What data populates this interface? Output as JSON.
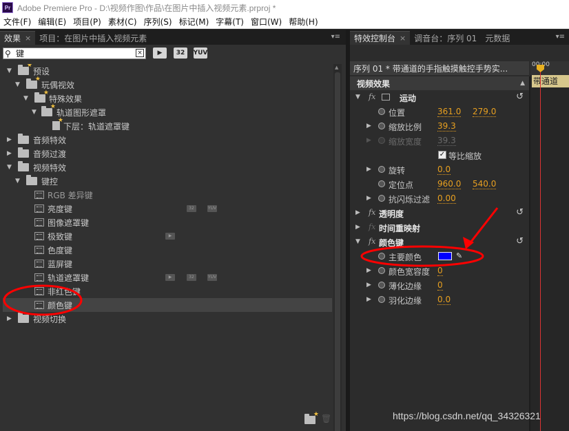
{
  "app": {
    "title": "Adobe Premiere Pro - D:\\视频作图\\作品\\在图片中插入视频元素.prproj *",
    "logo": "Pr"
  },
  "menu": [
    "文件(F)",
    "编辑(E)",
    "项目(P)",
    "素材(C)",
    "序列(S)",
    "标记(M)",
    "字幕(T)",
    "窗口(W)",
    "帮助(H)"
  ],
  "left_panel": {
    "tabs": [
      {
        "label": "效果",
        "close": "×",
        "active": true
      },
      {
        "label": "项目：在图片中插入视频元素",
        "active": false
      }
    ],
    "menu_icon": "▾≡",
    "search": {
      "value": "键",
      "clear": "×"
    },
    "filter_buttons": [
      "▶",
      "32",
      "YUV"
    ],
    "tree": [
      {
        "label": "预设",
        "level": 0,
        "kind": "folder-star",
        "expanded": true
      },
      {
        "label": "玩偶视效",
        "level": 1,
        "kind": "folder-star",
        "expanded": true
      },
      {
        "label": "特殊效果",
        "level": 2,
        "kind": "folder-star",
        "expanded": true
      },
      {
        "label": "轨道图形遮罩",
        "level": 3,
        "kind": "folder-star",
        "expanded": true
      },
      {
        "label": "下层：轨道遮罩键",
        "level": 4,
        "kind": "preset"
      },
      {
        "label": "音频特效",
        "level": 0,
        "kind": "folder",
        "expanded": false
      },
      {
        "label": "音频过渡",
        "level": 0,
        "kind": "folder",
        "expanded": false
      },
      {
        "label": "视频特效",
        "level": 0,
        "kind": "folder",
        "expanded": true
      },
      {
        "label": "键控",
        "level": 1,
        "kind": "folder",
        "expanded": true
      },
      {
        "label": "RGB 差异键",
        "level": 2,
        "kind": "effect",
        "dim": true
      },
      {
        "label": "亮度键",
        "level": 2,
        "kind": "effect",
        "badges": [
          "32",
          "YUV"
        ]
      },
      {
        "label": "图像遮罩键",
        "level": 2,
        "kind": "effect"
      },
      {
        "label": "极致键",
        "level": 2,
        "kind": "effect",
        "badges": [
          "acc"
        ]
      },
      {
        "label": "色度键",
        "level": 2,
        "kind": "effect"
      },
      {
        "label": "蓝屏键",
        "level": 2,
        "kind": "effect"
      },
      {
        "label": "轨道遮罩键",
        "level": 2,
        "kind": "effect",
        "badges": [
          "acc",
          "32",
          "YUV"
        ]
      },
      {
        "label": "非红色键",
        "level": 2,
        "kind": "effect"
      },
      {
        "label": "颜色键",
        "level": 2,
        "kind": "effect",
        "selected": true
      },
      {
        "label": "视频切换",
        "level": 0,
        "kind": "folder",
        "expanded": false
      }
    ]
  },
  "right_panel": {
    "tabs": [
      {
        "label": "特效控制台",
        "close": "×",
        "active": true
      },
      {
        "label": "调音台：序列 01",
        "active": false
      },
      {
        "label": "元数据",
        "active": false
      }
    ],
    "menu_icon": "▾≡",
    "sequence_label": "序列 01 * 带通道的手指触摸触控手势实...",
    "timecode": "00:00",
    "clip_label": "带通道",
    "section_title": "视频效果",
    "effects": [
      {
        "name": "运动",
        "expanded": true,
        "reset": true
      },
      {
        "name": "透明度",
        "expanded": false,
        "reset": true
      },
      {
        "name": "时间重映射",
        "expanded": false
      },
      {
        "name": "颜色键",
        "expanded": true,
        "reset": true
      }
    ],
    "motion_props": [
      {
        "name": "位置",
        "values": [
          "361.0",
          "279.0"
        ],
        "expandable": false
      },
      {
        "name": "缩放比例",
        "values": [
          "39.3"
        ],
        "expandable": true
      },
      {
        "name": "缩放宽度",
        "values": [
          "39.3"
        ],
        "expandable": true,
        "disabled": true
      },
      {
        "name": "旋转",
        "values": [
          "0.0"
        ],
        "expandable": true
      },
      {
        "name": "定位点",
        "values": [
          "960.0",
          "540.0"
        ],
        "expandable": false
      },
      {
        "name": "抗闪烁过滤",
        "values": [
          "0.00"
        ],
        "expandable": true
      }
    ],
    "uniform_scale": {
      "label": "等比缩放",
      "checked": true
    },
    "colorkey_props": [
      {
        "name": "主要颜色",
        "color": "#0000ff"
      },
      {
        "name": "颜色宽容度",
        "values": [
          "0"
        ]
      },
      {
        "name": "薄化边缘",
        "values": [
          "0"
        ]
      },
      {
        "name": "羽化边缘",
        "values": [
          "0.0"
        ]
      }
    ]
  },
  "watermark": "https://blog.csdn.net/qq_34326321",
  "annotation_color": "#ff0000"
}
